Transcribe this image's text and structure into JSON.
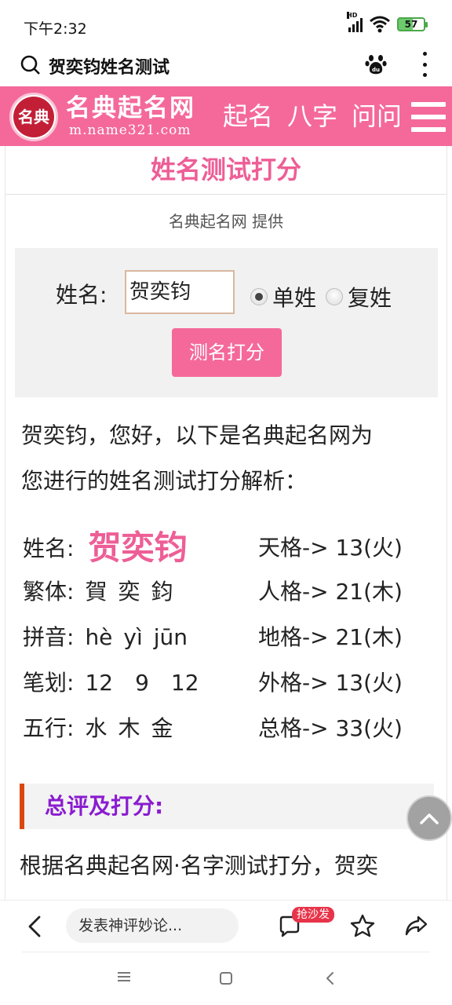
{
  "status_bar": {
    "time": "下午2:32",
    "battery": "57",
    "network": "HD"
  },
  "search_bar": {
    "query": "贺奕钧姓名测试"
  },
  "site": {
    "logo_text": "名典",
    "name": "名典起名网",
    "domain": "m.name321.com",
    "nav": [
      "起名",
      "八字",
      "问问"
    ]
  },
  "page": {
    "title": "姓名测试打分",
    "provider": "名典起名网 提供"
  },
  "form": {
    "name_label": "姓名:",
    "name_value": "贺奕钧",
    "radio_single": "单姓",
    "radio_double": "复姓",
    "selected": "单姓",
    "submit_label": "测名打分"
  },
  "intro": {
    "line1": "贺奕钧，您好，以下是名典起名网为",
    "line2": "您进行的姓名测试打分解析："
  },
  "details": {
    "name_label": "姓名:",
    "name": "贺奕钧",
    "traditional_label": "繁体:",
    "traditional": [
      "賀",
      "奕",
      "鈞"
    ],
    "pinyin_label": "拼音:",
    "pinyin": [
      "hè",
      "yì",
      "jūn"
    ],
    "strokes_label": "笔划:",
    "strokes": [
      "12",
      "9",
      "12"
    ],
    "wuxing_label": "五行:",
    "wuxing": [
      "水",
      "木",
      "金"
    ]
  },
  "grids": [
    "天格-> 13(火)",
    "人格-> 21(木)",
    "地格-> 21(木)",
    "外格-> 13(火)",
    "总格-> 33(火)"
  ],
  "summary": {
    "heading": "总评及打分:",
    "text": "根据名典起名网·名字测试打分，贺奕"
  },
  "comment_bar": {
    "placeholder": "发表神评妙论...",
    "badge": "抢沙发"
  },
  "colors": {
    "brand_pink": "#f4699a",
    "title_pink": "#ee5e96",
    "summary_purple": "#8a1ccf",
    "summary_accent": "#d9480f"
  }
}
